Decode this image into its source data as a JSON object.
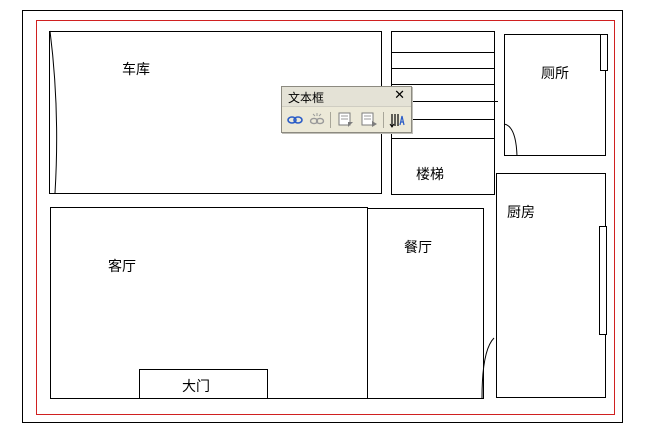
{
  "floor_plan": {
    "rooms": {
      "garage": "车库",
      "toilet": "厕所",
      "stairs": "楼梯",
      "kitchen": "厨房",
      "living_room": "客厅",
      "dining_room": "餐厅",
      "main_door": "大门"
    }
  },
  "textbox_toolbar": {
    "title": "文本框",
    "close_glyph": "✕",
    "buttons": [
      "link-icon",
      "break-link-icon",
      "previous-textbox-icon",
      "next-textbox-icon",
      "text-direction-icon"
    ]
  },
  "colors": {
    "margin_line": "#d02020",
    "toolbar_bg": "#ece9d8",
    "link_icon": "#2a5cc7"
  }
}
